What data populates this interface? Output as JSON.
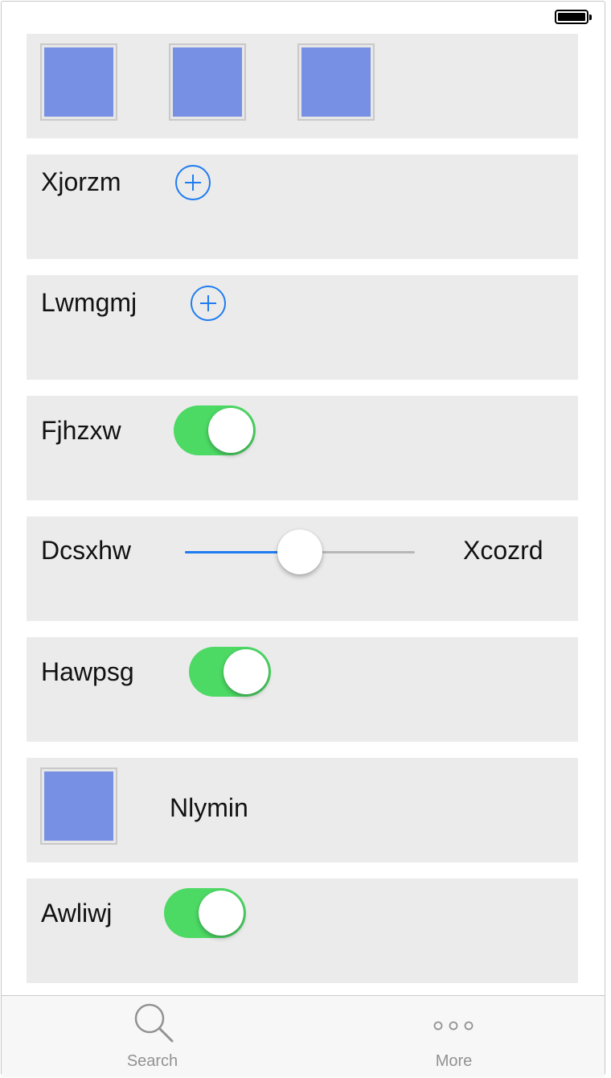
{
  "rows": [
    {
      "type": "images",
      "images": [
        "image-placeholder",
        "image-placeholder",
        "image-placeholder"
      ]
    },
    {
      "type": "add",
      "label": "Xjorzm"
    },
    {
      "type": "add",
      "label": "Lwmgmj"
    },
    {
      "type": "toggle",
      "label": "Fjhzxw",
      "on": true
    },
    {
      "type": "slider",
      "label": "Dcsxhw",
      "right_label": "Xcozrd",
      "value": 0.5
    },
    {
      "type": "toggle",
      "label": "Hawpsg",
      "on": true
    },
    {
      "type": "image-label",
      "label": "Nlymin"
    },
    {
      "type": "toggle",
      "label": "Awliwj",
      "on": true
    }
  ],
  "tabbar": {
    "search_label": "Search",
    "more_label": "More"
  },
  "colors": {
    "accent": "#1f7cf0",
    "toggle_on": "#4cd964",
    "thumbnail": "#7890e4",
    "row_bg": "#ebebeb"
  }
}
